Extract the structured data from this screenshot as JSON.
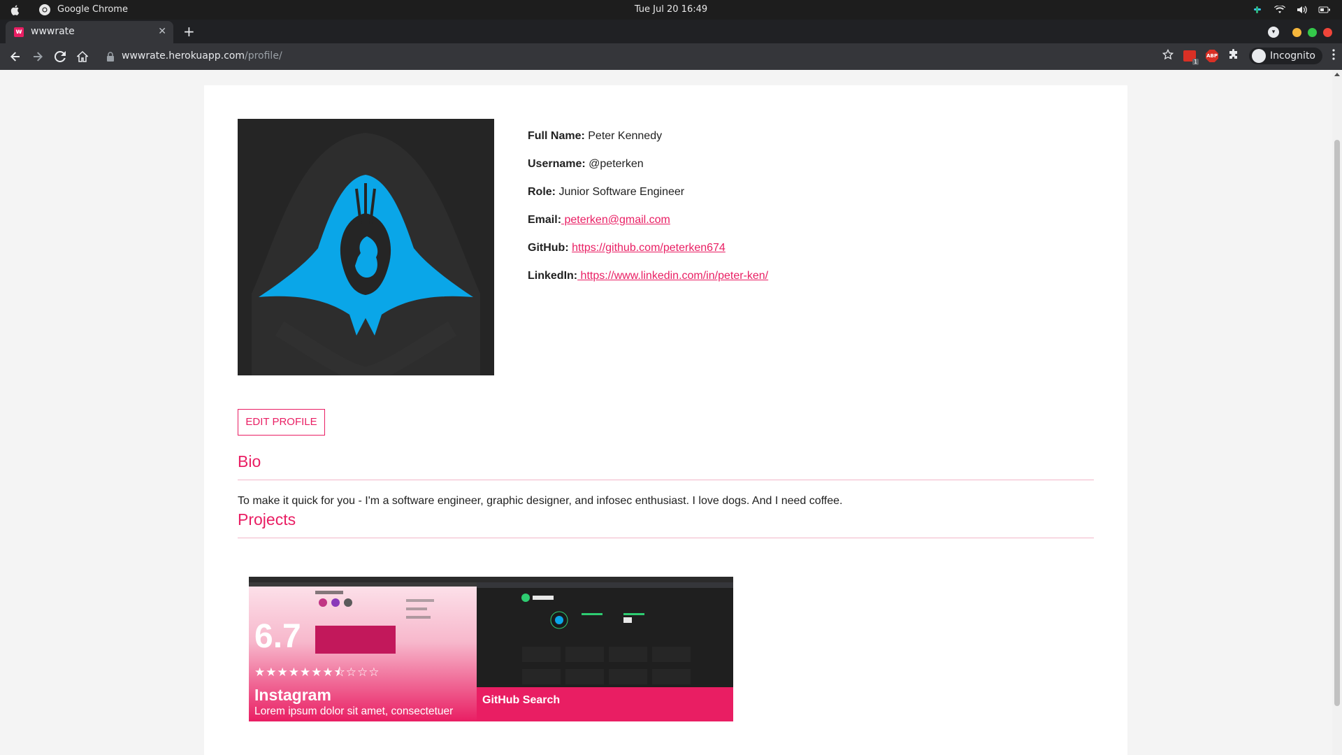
{
  "os": {
    "app_name": "Google Chrome",
    "clock": "Tue Jul 20  16:49"
  },
  "browser": {
    "tab_title": "wwwrate",
    "tab_favicon": "w",
    "url_host": "wwwrate.herokuapp.com",
    "url_path": "/profile/",
    "ext_badge_count": "1",
    "abp_label": "ABP",
    "incognito_label": "Incognito"
  },
  "profile": {
    "fields": [
      {
        "label": "Full Name:",
        "value": " Peter Kennedy",
        "is_link": false
      },
      {
        "label": "Username:",
        "value": " @peterken",
        "is_link": false
      },
      {
        "label": "Role:",
        "value": " Junior Software Engineer",
        "is_link": false
      },
      {
        "label": "Email:",
        "value": " peterken@gmail.com",
        "is_link": true
      },
      {
        "label": "GitHub:",
        "value": "https://github.com/peterken674",
        "is_link": true
      },
      {
        "label": "LinkedIn:",
        "value": " https://www.linkedin.com/in/peter-ken/",
        "is_link": true
      }
    ],
    "edit_button": "EDIT PROFILE"
  },
  "bio": {
    "title": "Bio",
    "text": "To make it quick for you - I'm a software engineer, graphic designer, and infosec enthusiast. I love dogs. And I need coffee."
  },
  "projects": {
    "title": "Projects",
    "items": [
      {
        "name": "Instagram",
        "score": "6.7",
        "stars": "★★★★★★★⯪☆☆☆",
        "rating_out_of_10": 6.7,
        "description": "Lorem ipsum dolor sit amet, consectetuer"
      },
      {
        "name": "GitHub Search"
      }
    ]
  },
  "colors": {
    "accent": "#e91e63",
    "avatar_bg": "#252525",
    "avatar_hood": "#0aa6e8"
  }
}
